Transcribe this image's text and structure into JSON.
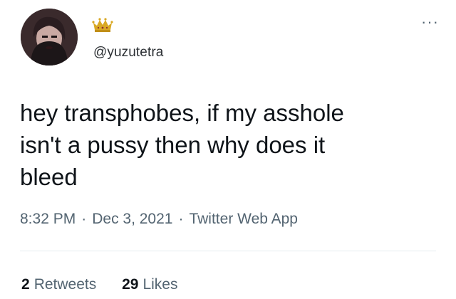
{
  "tweet": {
    "handle": "@yuzutetra",
    "text_lines": [
      "hey transphobes, if my asshole",
      "isn't a pussy then why does it",
      "bleed"
    ],
    "time": "8:32 PM",
    "date": "Dec 3, 2021",
    "source": "Twitter Web App",
    "separator": "·",
    "more_glyph": "···",
    "stats": {
      "retweets_count": "2",
      "retweets_label": "Retweets",
      "likes_count": "29",
      "likes_label": "Likes"
    }
  },
  "icons": {
    "avatar": "avatar-photo",
    "badge": "crown-icon",
    "menu": "more-options-icon"
  },
  "colors": {
    "text_primary": "#0f1419",
    "text_secondary": "#536471",
    "crown_gold": "#d9a824",
    "divider": "#e6ecf0"
  }
}
